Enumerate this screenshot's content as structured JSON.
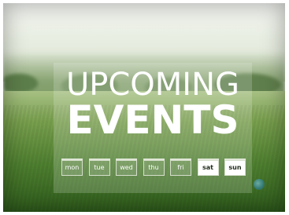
{
  "title": {
    "line1": "UPCOMING",
    "line2": "EVENTS"
  },
  "days": [
    {
      "label": "mon",
      "weekend": false
    },
    {
      "label": "tue",
      "weekend": false
    },
    {
      "label": "wed",
      "weekend": false
    },
    {
      "label": "thu",
      "weekend": false
    },
    {
      "label": "fri",
      "weekend": false
    },
    {
      "label": "sat",
      "weekend": true
    },
    {
      "label": "sun",
      "weekend": true
    }
  ]
}
